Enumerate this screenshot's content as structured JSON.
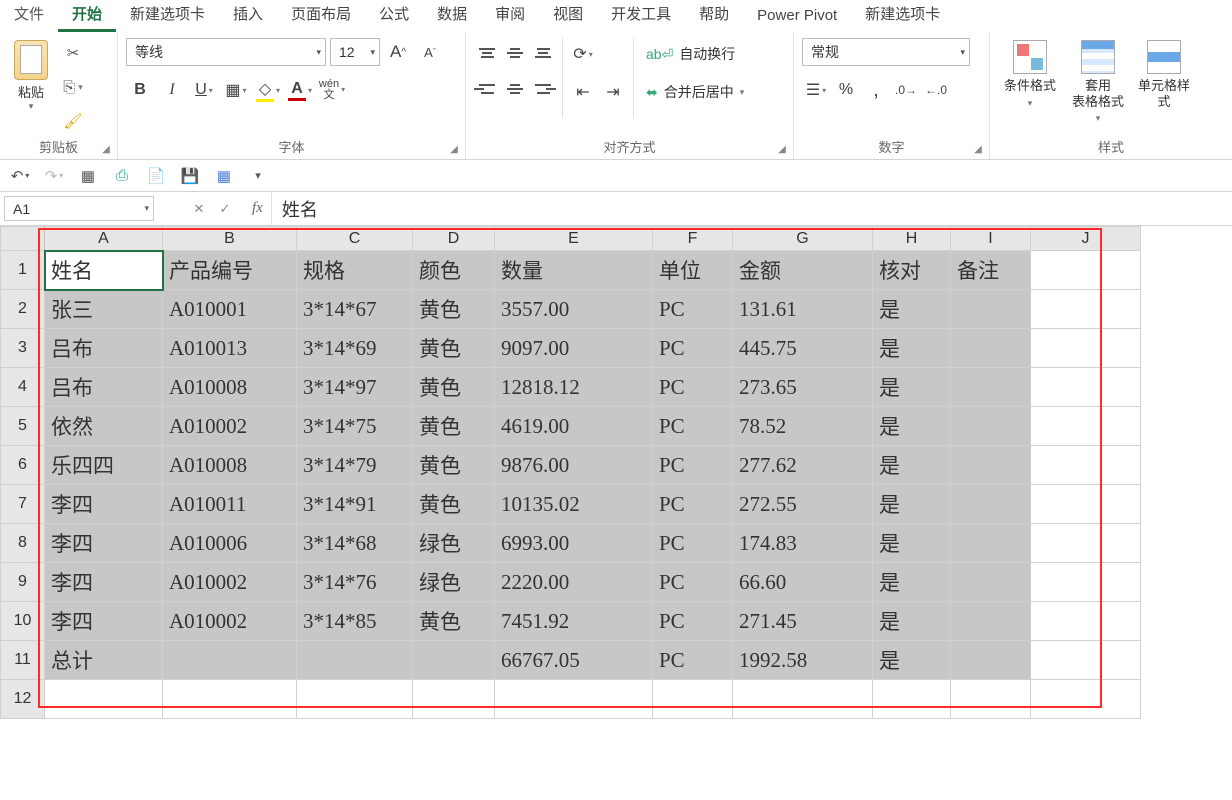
{
  "menu": {
    "items": [
      "文件",
      "开始",
      "新建选项卡",
      "插入",
      "页面布局",
      "公式",
      "数据",
      "审阅",
      "视图",
      "开发工具",
      "帮助",
      "Power Pivot",
      "新建选项卡"
    ],
    "active_index": 1
  },
  "ribbon": {
    "clipboard": {
      "paste": "粘贴",
      "label": "剪贴板"
    },
    "font": {
      "name": "等线",
      "size": "12",
      "label": "字体"
    },
    "alignment": {
      "wrap": "自动换行",
      "merge": "合并后居中",
      "label": "对齐方式"
    },
    "number": {
      "format": "常规",
      "label": "数字"
    },
    "styles": {
      "cond": "条件格式",
      "table": "套用\n表格格式",
      "cell": "单元格样式",
      "label": "样式"
    }
  },
  "namebox": "A1",
  "formula": "姓名",
  "columns": [
    "A",
    "B",
    "C",
    "D",
    "E",
    "F",
    "G",
    "H",
    "I",
    "J"
  ],
  "row_headers": [
    1,
    2,
    3,
    4,
    5,
    6,
    7,
    8,
    9,
    10,
    11,
    12
  ],
  "table": {
    "headers": [
      "姓名",
      "产品编号",
      "规格",
      "颜色",
      "数量",
      "单位",
      "金额",
      "核对",
      "备注"
    ],
    "rows": [
      [
        "张三",
        "A010001",
        "3*14*67",
        "黄色",
        "3557.00",
        "PC",
        "131.61",
        "是",
        ""
      ],
      [
        "吕布",
        "A010013",
        "3*14*69",
        "黄色",
        "9097.00",
        "PC",
        "445.75",
        "是",
        ""
      ],
      [
        "吕布",
        "A010008",
        "3*14*97",
        "黄色",
        "12818.12",
        "PC",
        "273.65",
        "是",
        ""
      ],
      [
        "依然",
        "A010002",
        "3*14*75",
        "黄色",
        "4619.00",
        "PC",
        "78.52",
        "是",
        ""
      ],
      [
        "乐四四",
        "A010008",
        "3*14*79",
        "黄色",
        "9876.00",
        "PC",
        "277.62",
        "是",
        ""
      ],
      [
        "李四",
        "A010011",
        "3*14*91",
        "黄色",
        "10135.02",
        "PC",
        "272.55",
        "是",
        ""
      ],
      [
        "李四",
        "A010006",
        "3*14*68",
        "绿色",
        "6993.00",
        "PC",
        "174.83",
        "是",
        ""
      ],
      [
        "李四",
        "A010002",
        "3*14*76",
        "绿色",
        "2220.00",
        "PC",
        "66.60",
        "是",
        ""
      ],
      [
        "李四",
        "A010002",
        "3*14*85",
        "黄色",
        "7451.92",
        "PC",
        "271.45",
        "是",
        ""
      ],
      [
        "总计",
        "",
        "",
        "",
        "66767.05",
        "PC",
        "1992.58",
        "是",
        ""
      ]
    ]
  }
}
